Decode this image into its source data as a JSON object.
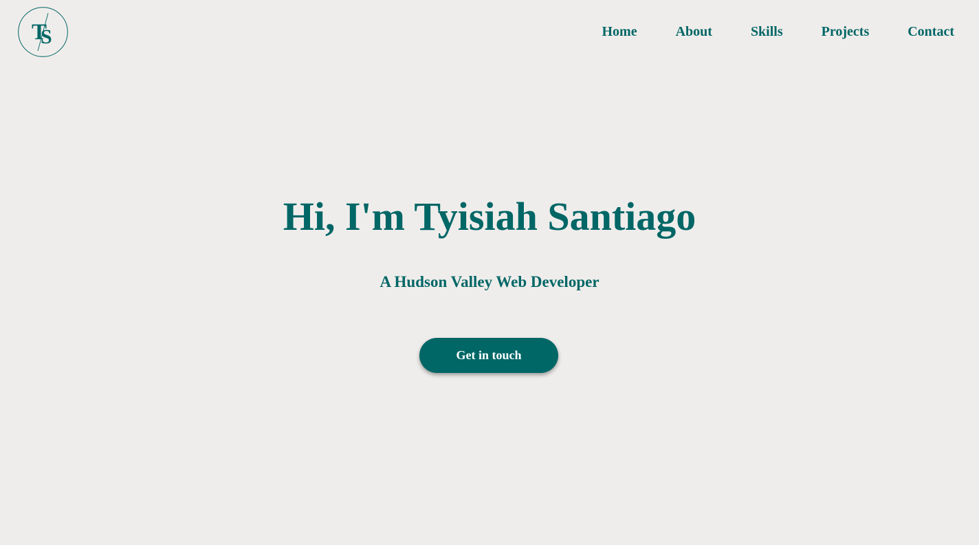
{
  "header": {
    "logo": {
      "letter_1": "T",
      "letter_2": "S",
      "color": "#006666"
    },
    "nav": [
      {
        "label": "Home"
      },
      {
        "label": "About"
      },
      {
        "label": "Skills"
      },
      {
        "label": "Projects"
      },
      {
        "label": "Contact"
      }
    ]
  },
  "hero": {
    "title": "Hi, I'm Tyisiah Santiago",
    "subtitle": "A Hudson Valley Web Developer",
    "cta_label": "Get in touch"
  },
  "theme": {
    "background": "#efedeb",
    "accent": "#006666",
    "button_text": "#ffffff"
  }
}
